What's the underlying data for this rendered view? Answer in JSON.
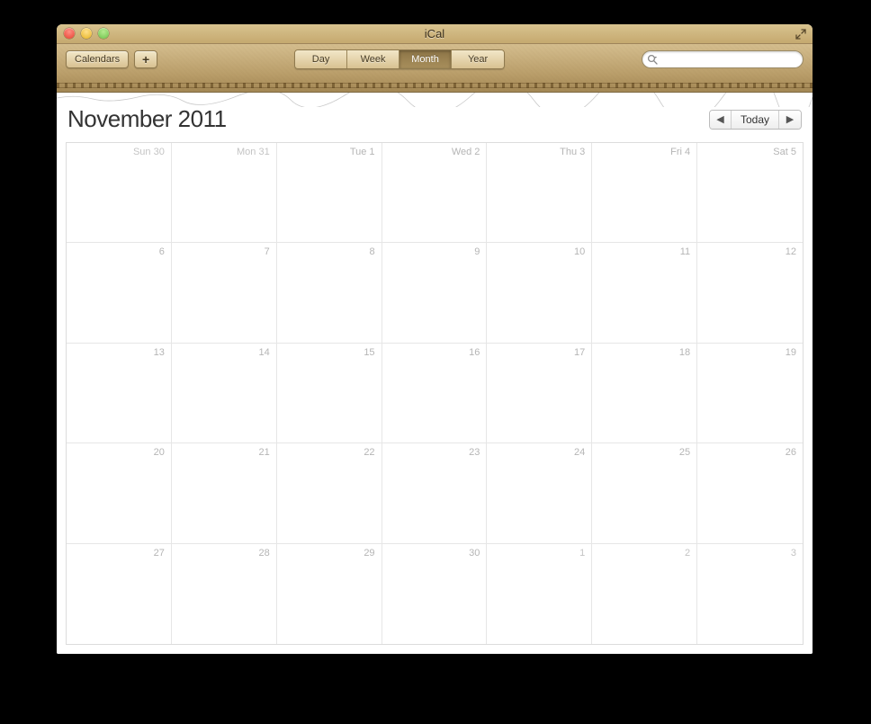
{
  "window": {
    "title": "iCal"
  },
  "toolbar": {
    "calendars_label": "Calendars",
    "add_label": "+",
    "views": {
      "day": "Day",
      "week": "Week",
      "month": "Month",
      "year": "Year",
      "active": "Month"
    },
    "search_placeholder": ""
  },
  "header": {
    "month": "November",
    "year": "2011",
    "today_label": "Today",
    "prev_glyph": "◀",
    "next_glyph": "▶"
  },
  "weekdays": [
    "Sun",
    "Mon",
    "Tue",
    "Wed",
    "Thu",
    "Fri",
    "Sat"
  ],
  "days": [
    {
      "label": "Sun 30",
      "in_month": false
    },
    {
      "label": "Mon 31",
      "in_month": false
    },
    {
      "label": "Tue 1",
      "in_month": true
    },
    {
      "label": "Wed 2",
      "in_month": true
    },
    {
      "label": "Thu 3",
      "in_month": true
    },
    {
      "label": "Fri 4",
      "in_month": true
    },
    {
      "label": "Sat 5",
      "in_month": true
    },
    {
      "label": "6",
      "in_month": true
    },
    {
      "label": "7",
      "in_month": true
    },
    {
      "label": "8",
      "in_month": true
    },
    {
      "label": "9",
      "in_month": true
    },
    {
      "label": "10",
      "in_month": true
    },
    {
      "label": "11",
      "in_month": true
    },
    {
      "label": "12",
      "in_month": true
    },
    {
      "label": "13",
      "in_month": true
    },
    {
      "label": "14",
      "in_month": true
    },
    {
      "label": "15",
      "in_month": true
    },
    {
      "label": "16",
      "in_month": true
    },
    {
      "label": "17",
      "in_month": true
    },
    {
      "label": "18",
      "in_month": true
    },
    {
      "label": "19",
      "in_month": true
    },
    {
      "label": "20",
      "in_month": true
    },
    {
      "label": "21",
      "in_month": true
    },
    {
      "label": "22",
      "in_month": true
    },
    {
      "label": "23",
      "in_month": true
    },
    {
      "label": "24",
      "in_month": true
    },
    {
      "label": "25",
      "in_month": true
    },
    {
      "label": "26",
      "in_month": true
    },
    {
      "label": "27",
      "in_month": true
    },
    {
      "label": "28",
      "in_month": true
    },
    {
      "label": "29",
      "in_month": true
    },
    {
      "label": "30",
      "in_month": true
    },
    {
      "label": "1",
      "in_month": false
    },
    {
      "label": "2",
      "in_month": false
    },
    {
      "label": "3",
      "in_month": false
    }
  ]
}
